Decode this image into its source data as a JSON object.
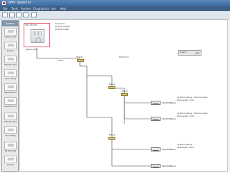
{
  "window": {
    "title": "DMV Selector"
  },
  "menu": [
    "File",
    "Tools",
    "System",
    "Diagnostics",
    "Ver",
    "Help"
  ],
  "sidebar": {
    "header": "System",
    "items": [
      {
        "label": "Outdoor Unit"
      },
      {
        "label": "Branch"
      },
      {
        "label": "Wall Mounted"
      },
      {
        "label": "Floor Celling"
      },
      {
        "label": "High ESP Duct"
      },
      {
        "label": "Low ESP Duct"
      },
      {
        "label": "Wall Mounted"
      },
      {
        "label": "Floor Hiding"
      },
      {
        "label": "PN Wall Type"
      },
      {
        "label": "Console"
      }
    ]
  },
  "diagram": {
    "outdoor_unit": {
      "card_title": "DMV-D340WT",
      "name": "System_DMV"
    },
    "outdoor_info": "ID Branch 1",
    "outdoor_details": [
      "ID Branch Name",
      "ID Branch label"
    ],
    "pipe_main": "0.0kW",
    "branches": [
      {
        "name": "Branch"
      },
      {
        "name": "Branch"
      },
      {
        "name": "Branch"
      },
      {
        "name": "Branch"
      }
    ],
    "legend": "Legend",
    "indoor_units": [
      {
        "name": "Wall RHAEBw-A",
        "detail": [
          "ID Branch Name : ID Branch label",
          "Pipe Length : 0.0m"
        ]
      },
      {
        "name": "Wall RHAEBw-A",
        "detail": [
          "ID Branch Name : ID Branch label",
          "Pipe Length : 0.0m"
        ]
      },
      {
        "name": "Wall RHAEBw-A",
        "detail": [
          "ID Branch Name",
          "Pipe length : 0.0m"
        ]
      },
      {
        "name": "Wall RHAEBw-A",
        "detail": [
          "ID Branch Name",
          "Pipe length : 0.0m"
        ]
      }
    ]
  }
}
